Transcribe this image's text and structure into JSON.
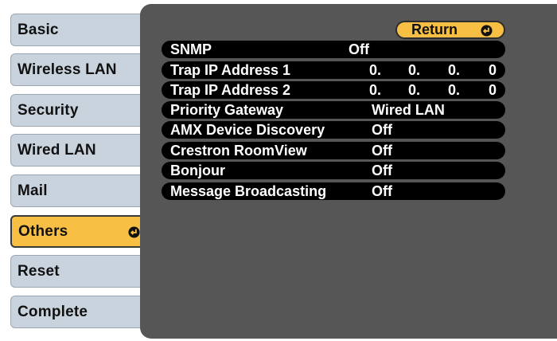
{
  "sidebar": {
    "items": [
      {
        "label": "Basic"
      },
      {
        "label": "Wireless LAN"
      },
      {
        "label": "Security"
      },
      {
        "label": "Wired LAN"
      },
      {
        "label": "Mail"
      },
      {
        "label": "Others",
        "selected": true
      },
      {
        "label": "Reset"
      },
      {
        "label": "Complete"
      }
    ]
  },
  "return_button": {
    "label": "Return"
  },
  "settings": {
    "snmp": {
      "label": "SNMP",
      "value": "Off"
    },
    "trap1": {
      "label": "Trap IP Address 1",
      "octets": [
        "0.",
        "0.",
        "0.",
        "0"
      ]
    },
    "trap2": {
      "label": "Trap IP Address 2",
      "octets": [
        "0.",
        "0.",
        "0.",
        "0"
      ]
    },
    "priority_gateway": {
      "label": "Priority Gateway",
      "value": "Wired LAN"
    },
    "amx": {
      "label": "AMX Device Discovery",
      "value": "Off"
    },
    "crestron": {
      "label": "Crestron RoomView",
      "value": "Off"
    },
    "bonjour": {
      "label": "Bonjour",
      "value": "Off"
    },
    "message_broadcasting": {
      "label": "Message Broadcasting",
      "value": "Off"
    }
  },
  "colors": {
    "accent": "#f8bf45",
    "tab": "#c9d3dd",
    "panel": "#565656",
    "row": "#000000"
  }
}
